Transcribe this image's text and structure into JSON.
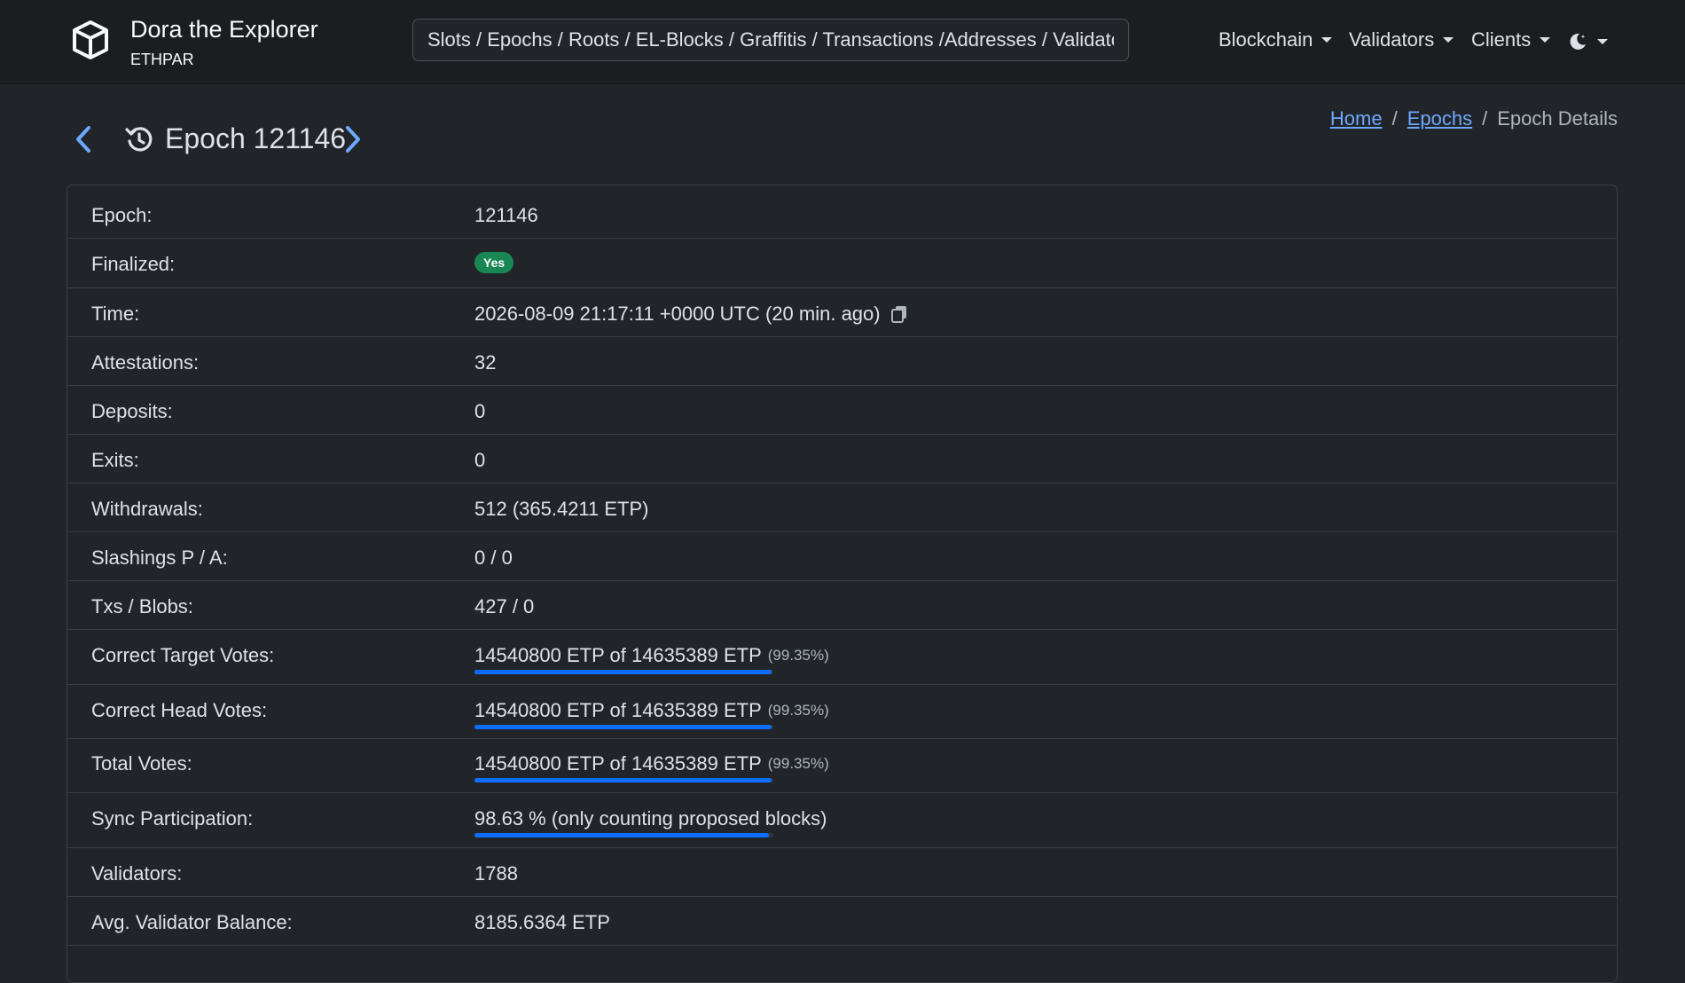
{
  "navbar": {
    "brand_title": "Dora the Explorer",
    "brand_sub": "ETHPAR",
    "brand_icon": "cube-icon",
    "search_placeholder": "Slots / Epochs / Roots / EL-Blocks / Graffitis / Transactions /Addresses / Validators",
    "menu": [
      {
        "label": "Blockchain"
      },
      {
        "label": "Validators"
      },
      {
        "label": "Clients"
      }
    ],
    "theme_icon": "moon-stars-icon"
  },
  "header": {
    "prev_icon": "chevron-left-icon",
    "next_icon": "chevron-right-icon",
    "history_icon": "history-icon",
    "title": "Epoch 121146",
    "breadcrumb": {
      "home": "Home",
      "epochs": "Epochs",
      "current": "Epoch Details",
      "separator": "/"
    }
  },
  "colors": {
    "accent": "#0d6efd",
    "success": "#198754",
    "link": "#6ea8fe",
    "background": "#212529"
  },
  "rows": [
    {
      "label": "Epoch:",
      "value": "121146"
    },
    {
      "label": "Finalized:",
      "badge": "Yes"
    },
    {
      "label": "Time:",
      "value": "2026-08-09 21:17:11 +0000 UTC (20 min. ago)",
      "icon": "copy-icon"
    },
    {
      "label": "Attestations:",
      "value": "32"
    },
    {
      "label": "Deposits:",
      "value": "0"
    },
    {
      "label": "Exits:",
      "value": "0"
    },
    {
      "label": "Withdrawals:",
      "value": "512 (365.4211 ETP)"
    },
    {
      "label": "Slashings P / A:",
      "value": "0 / 0"
    },
    {
      "label": "Txs / Blobs:",
      "value": "427 / 0"
    },
    {
      "label": "Correct Target Votes:",
      "value": "14540800 ETP of 14635389 ETP",
      "percent": "(99.35%)",
      "progress": 0.9935
    },
    {
      "label": "Correct Head Votes:",
      "value": "14540800 ETP of 14635389 ETP",
      "percent": "(99.35%)",
      "progress": 0.9935
    },
    {
      "label": "Total Votes:",
      "value": "14540800 ETP of 14635389 ETP",
      "percent": "(99.35%)",
      "progress": 0.9935
    },
    {
      "label": "Sync Participation:",
      "value": "98.63 % (only counting proposed blocks)",
      "progress": 0.9863
    },
    {
      "label": "Validators:",
      "value": "1788"
    },
    {
      "label": "Avg. Validator Balance:",
      "value": "8185.6364 ETP"
    }
  ]
}
